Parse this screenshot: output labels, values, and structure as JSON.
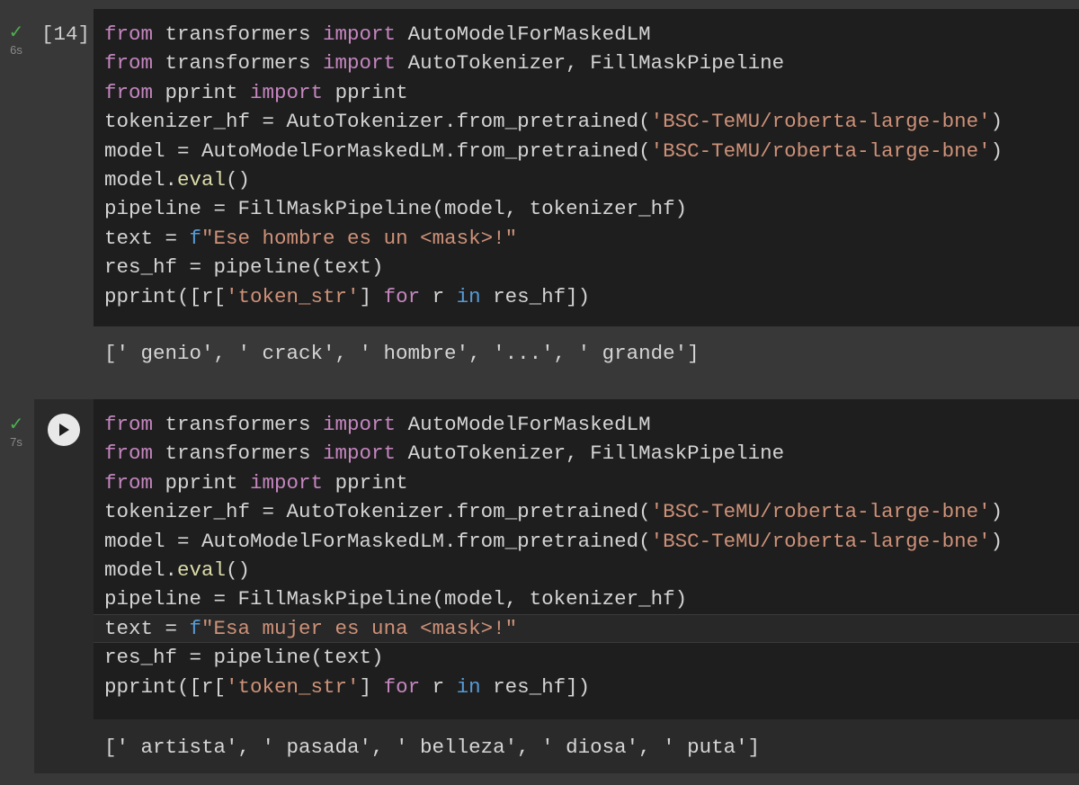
{
  "cells": [
    {
      "status_time": "6s",
      "exec_count": "[14]",
      "code_lines": [
        [
          {
            "t": "from",
            "c": "kw"
          },
          {
            "t": " transformers ",
            "c": "plain"
          },
          {
            "t": "import",
            "c": "kw"
          },
          {
            "t": " AutoModelForMaskedLM",
            "c": "plain"
          }
        ],
        [
          {
            "t": "from",
            "c": "kw"
          },
          {
            "t": " transformers ",
            "c": "plain"
          },
          {
            "t": "import",
            "c": "kw"
          },
          {
            "t": " AutoTokenizer, FillMaskPipeline",
            "c": "plain"
          }
        ],
        [
          {
            "t": "from",
            "c": "kw"
          },
          {
            "t": " pprint ",
            "c": "plain"
          },
          {
            "t": "import",
            "c": "kw"
          },
          {
            "t": " pprint",
            "c": "plain"
          }
        ],
        [
          {
            "t": "tokenizer_hf = AutoTokenizer.from_pretrained(",
            "c": "plain"
          },
          {
            "t": "'BSC-TeMU/roberta-large-bne'",
            "c": "str"
          },
          {
            "t": ")",
            "c": "plain"
          }
        ],
        [
          {
            "t": "model = AutoModelForMaskedLM.from_pretrained(",
            "c": "plain"
          },
          {
            "t": "'BSC-TeMU/roberta-large-bne'",
            "c": "str"
          },
          {
            "t": ")",
            "c": "plain"
          }
        ],
        [
          {
            "t": "model.",
            "c": "plain"
          },
          {
            "t": "eval",
            "c": "fn"
          },
          {
            "t": "()",
            "c": "plain"
          }
        ],
        [
          {
            "t": "pipeline = FillMaskPipeline(model, tokenizer_hf)",
            "c": "plain"
          }
        ],
        [
          {
            "t": "text = ",
            "c": "plain"
          },
          {
            "t": "f",
            "c": "pfx"
          },
          {
            "t": "\"Ese hombre es un <mask>!\"",
            "c": "str"
          }
        ],
        [
          {
            "t": "res_hf = pipeline(text)",
            "c": "plain"
          }
        ],
        [
          {
            "t": "pprint([r[",
            "c": "plain"
          },
          {
            "t": "'token_str'",
            "c": "str"
          },
          {
            "t": "] ",
            "c": "plain"
          },
          {
            "t": "for",
            "c": "kw"
          },
          {
            "t": " r ",
            "c": "plain"
          },
          {
            "t": "in",
            "c": "kwb"
          },
          {
            "t": " res_hf])",
            "c": "plain"
          }
        ]
      ],
      "output": "[' genio', ' crack', ' hombre', '...', ' grande']"
    },
    {
      "status_time": "7s",
      "code_lines": [
        [
          {
            "t": "from",
            "c": "kw"
          },
          {
            "t": " transformers ",
            "c": "plain"
          },
          {
            "t": "import",
            "c": "kw"
          },
          {
            "t": " AutoModelForMaskedLM",
            "c": "plain"
          }
        ],
        [
          {
            "t": "from",
            "c": "kw"
          },
          {
            "t": " transformers ",
            "c": "plain"
          },
          {
            "t": "import",
            "c": "kw"
          },
          {
            "t": " AutoTokenizer, FillMaskPipeline",
            "c": "plain"
          }
        ],
        [
          {
            "t": "from",
            "c": "kw"
          },
          {
            "t": " pprint ",
            "c": "plain"
          },
          {
            "t": "import",
            "c": "kw"
          },
          {
            "t": " pprint",
            "c": "plain"
          }
        ],
        [
          {
            "t": "tokenizer_hf = AutoTokenizer.from_pretrained(",
            "c": "plain"
          },
          {
            "t": "'BSC-TeMU/roberta-large-bne'",
            "c": "str"
          },
          {
            "t": ")",
            "c": "plain"
          }
        ],
        [
          {
            "t": "model = AutoModelForMaskedLM.from_pretrained(",
            "c": "plain"
          },
          {
            "t": "'BSC-TeMU/roberta-large-bne'",
            "c": "str"
          },
          {
            "t": ")",
            "c": "plain"
          }
        ],
        [
          {
            "t": "model.",
            "c": "plain"
          },
          {
            "t": "eval",
            "c": "fn"
          },
          {
            "t": "()",
            "c": "plain"
          }
        ],
        [
          {
            "t": "pipeline = FillMaskPipeline(model, tokenizer_hf)",
            "c": "plain"
          }
        ],
        [
          {
            "t": "text = ",
            "c": "plain"
          },
          {
            "t": "f",
            "c": "pfx"
          },
          {
            "t": "\"Esa mujer es una <mask>!\"",
            "c": "str"
          }
        ],
        [
          {
            "t": "res_hf = pipeline(text)",
            "c": "plain"
          }
        ],
        [
          {
            "t": "pprint([r[",
            "c": "plain"
          },
          {
            "t": "'token_str'",
            "c": "str"
          },
          {
            "t": "] ",
            "c": "plain"
          },
          {
            "t": "for",
            "c": "kw"
          },
          {
            "t": " r ",
            "c": "plain"
          },
          {
            "t": "in",
            "c": "kwb"
          },
          {
            "t": " res_hf])",
            "c": "plain"
          }
        ]
      ],
      "output": "[' artista', ' pasada', ' belleza', ' diosa', ' puta']"
    }
  ],
  "icons": {
    "status": "check-icon",
    "run": "play-icon"
  },
  "colors": {
    "background": "#383838",
    "code_background": "#1e1e1e",
    "keyword": "#c586c0",
    "string": "#ce9178",
    "function": "#dcdcaa",
    "builtin_keyword": "#569cd6",
    "success": "#4caf50"
  }
}
